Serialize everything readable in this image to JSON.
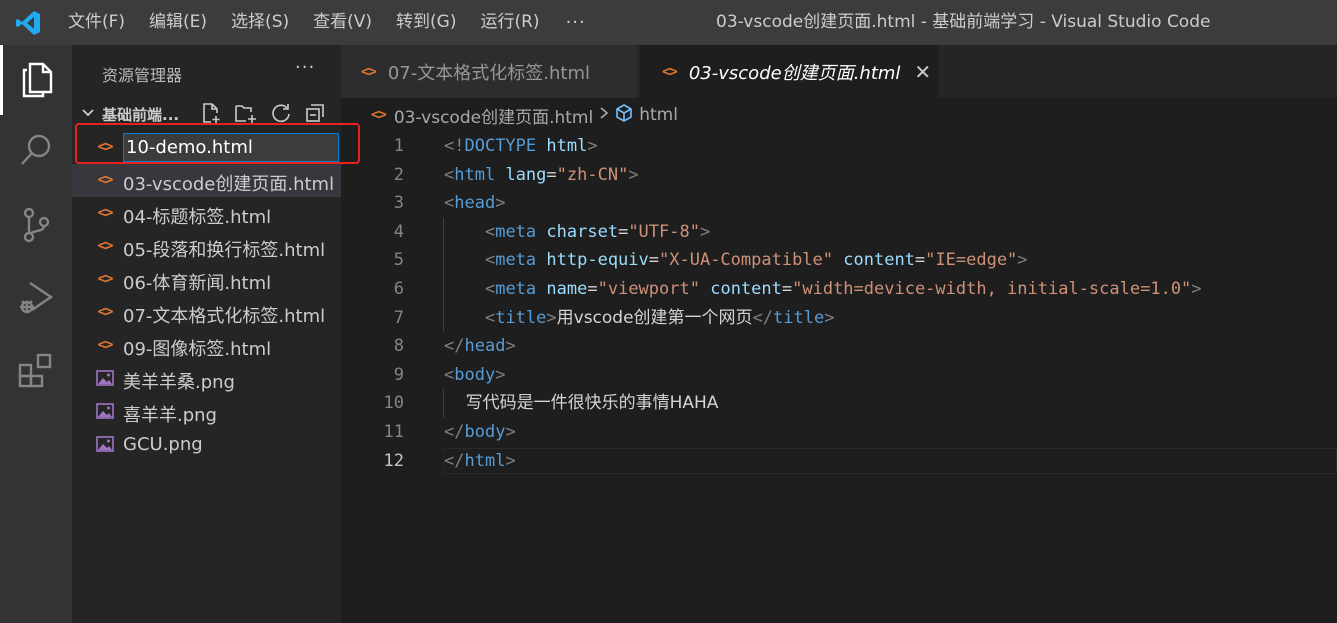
{
  "titlebar": {
    "menu": [
      "文件(F)",
      "编辑(E)",
      "选择(S)",
      "查看(V)",
      "转到(G)",
      "运行(R)"
    ],
    "more": "···",
    "window_title": "03-vscode创建页面.html - 基础前端学习 - Visual Studio Code"
  },
  "activity_bar": [
    "explorer-icon",
    "search-icon",
    "source-control-icon",
    "run-debug-icon",
    "extensions-icon"
  ],
  "sidebar": {
    "title": "资源管理器",
    "more": "···",
    "folder": "基础前端...",
    "rename_value": "10-demo.html",
    "files": [
      {
        "name": "03-vscode创建页面.html",
        "type": "html",
        "selected": true
      },
      {
        "name": "04-标题标签.html",
        "type": "html"
      },
      {
        "name": "05-段落和换行标签.html",
        "type": "html"
      },
      {
        "name": "06-体育新闻.html",
        "type": "html"
      },
      {
        "name": "07-文本格式化标签.html",
        "type": "html"
      },
      {
        "name": "09-图像标签.html",
        "type": "html"
      },
      {
        "name": "美羊羊桑.png",
        "type": "image"
      },
      {
        "name": "喜羊羊.png",
        "type": "image"
      },
      {
        "name": "GCU.png",
        "type": "image"
      }
    ]
  },
  "tabs": [
    {
      "label": "07-文本格式化标签.html",
      "active": false
    },
    {
      "label": "03-vscode创建页面.html",
      "active": true,
      "close": "✕"
    }
  ],
  "breadcrumb": {
    "file": "03-vscode创建页面.html",
    "symbol": "html"
  },
  "editor": {
    "current_line": 12,
    "lines": [
      {
        "n": "1",
        "tokens": [
          [
            "brk",
            "<!"
          ],
          [
            "tag",
            "DOCTYPE"
          ],
          [
            "txt",
            " "
          ],
          [
            "attr",
            "html"
          ],
          [
            "brk",
            ">"
          ]
        ]
      },
      {
        "n": "2",
        "tokens": [
          [
            "brk",
            "<"
          ],
          [
            "tag",
            "html"
          ],
          [
            "txt",
            " "
          ],
          [
            "attr",
            "lang"
          ],
          [
            "txt",
            "="
          ],
          [
            "str",
            "\"zh-CN\""
          ],
          [
            "brk",
            ">"
          ]
        ]
      },
      {
        "n": "3",
        "tokens": [
          [
            "brk",
            "<"
          ],
          [
            "tag",
            "head"
          ],
          [
            "brk",
            ">"
          ]
        ]
      },
      {
        "n": "4",
        "tokens": [
          [
            "txt",
            "    "
          ],
          [
            "brk",
            "<"
          ],
          [
            "tag",
            "meta"
          ],
          [
            "txt",
            " "
          ],
          [
            "attr",
            "charset"
          ],
          [
            "txt",
            "="
          ],
          [
            "str",
            "\"UTF-8\""
          ],
          [
            "brk",
            ">"
          ]
        ]
      },
      {
        "n": "5",
        "tokens": [
          [
            "txt",
            "    "
          ],
          [
            "brk",
            "<"
          ],
          [
            "tag",
            "meta"
          ],
          [
            "txt",
            " "
          ],
          [
            "attr",
            "http-equiv"
          ],
          [
            "txt",
            "="
          ],
          [
            "str",
            "\"X-UA-Compatible\""
          ],
          [
            "txt",
            " "
          ],
          [
            "attr",
            "content"
          ],
          [
            "txt",
            "="
          ],
          [
            "str",
            "\"IE=edge\""
          ],
          [
            "brk",
            ">"
          ]
        ]
      },
      {
        "n": "6",
        "tokens": [
          [
            "txt",
            "    "
          ],
          [
            "brk",
            "<"
          ],
          [
            "tag",
            "meta"
          ],
          [
            "txt",
            " "
          ],
          [
            "attr",
            "name"
          ],
          [
            "txt",
            "="
          ],
          [
            "str",
            "\"viewport\""
          ],
          [
            "txt",
            " "
          ],
          [
            "attr",
            "content"
          ],
          [
            "txt",
            "="
          ],
          [
            "str",
            "\"width=device-width, initial-scale=1.0\""
          ],
          [
            "brk",
            ">"
          ]
        ]
      },
      {
        "n": "7",
        "tokens": [
          [
            "txt",
            "    "
          ],
          [
            "brk",
            "<"
          ],
          [
            "tag",
            "title"
          ],
          [
            "brk",
            ">"
          ],
          [
            "txt",
            "用vscode创建第一个网页"
          ],
          [
            "brk",
            "</"
          ],
          [
            "tag",
            "title"
          ],
          [
            "brk",
            ">"
          ]
        ]
      },
      {
        "n": "8",
        "tokens": [
          [
            "brk",
            "</"
          ],
          [
            "tag",
            "head"
          ],
          [
            "brk",
            ">"
          ]
        ]
      },
      {
        "n": "9",
        "tokens": [
          [
            "brk",
            "<"
          ],
          [
            "tag",
            "body"
          ],
          [
            "brk",
            ">"
          ]
        ]
      },
      {
        "n": "10",
        "tokens": [
          [
            "txt",
            "    写代码是一件很快乐的事情HAHA"
          ]
        ]
      },
      {
        "n": "11",
        "tokens": [
          [
            "brk",
            "</"
          ],
          [
            "tag",
            "body"
          ],
          [
            "brk",
            ">"
          ]
        ]
      },
      {
        "n": "12",
        "tokens": [
          [
            "brk",
            "</"
          ],
          [
            "tag",
            "html"
          ],
          [
            "brk",
            ">"
          ]
        ]
      }
    ]
  }
}
